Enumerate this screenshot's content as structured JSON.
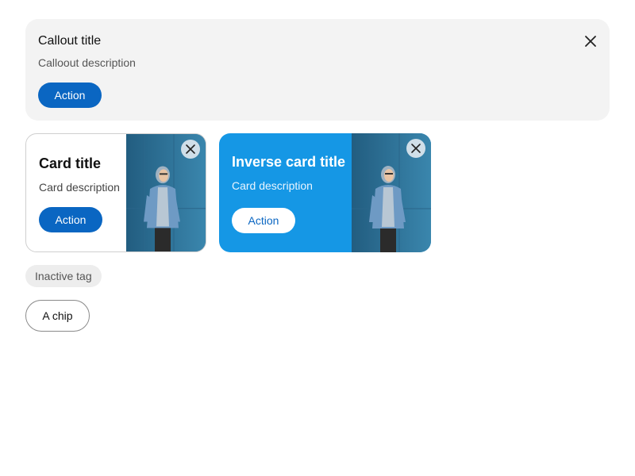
{
  "callout": {
    "title": "Callout title",
    "description": "Calloout description",
    "action_label": "Action",
    "close_icon": "close-icon",
    "background": "#f3f3f3",
    "accent": "#0a66c2"
  },
  "cards": [
    {
      "variant": "default",
      "title": "Card title",
      "description": "Card description",
      "action_label": "Action",
      "image": "photo of person in hoodie and denim jacket",
      "close_icon": "close-icon",
      "background": "#ffffff"
    },
    {
      "variant": "inverse",
      "title": "Inverse card title",
      "description": "Card description",
      "action_label": "Action",
      "image": "photo of person in hoodie and denim jacket",
      "close_icon": "close-icon",
      "background": "#1597e5"
    }
  ],
  "tag": {
    "label": "Inactive tag"
  },
  "chip": {
    "label": "A chip"
  }
}
